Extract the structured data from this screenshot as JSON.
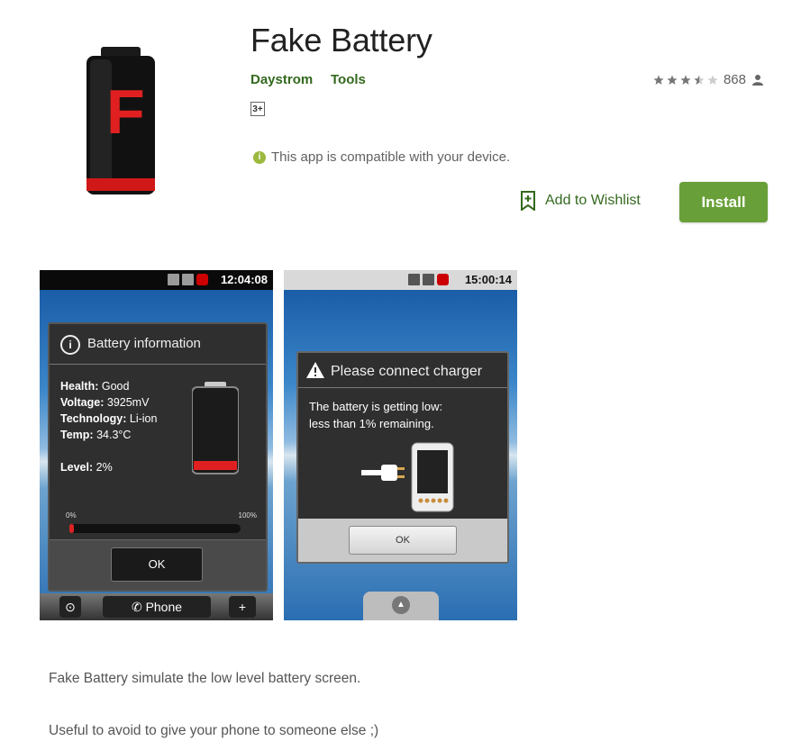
{
  "app": {
    "title": "Fake Battery",
    "developer": "Daystrom",
    "category": "Tools",
    "content_rating": "3+",
    "rating_stars": 3.5,
    "rating_count": "868",
    "compatibility": "This app is compatible with your device.",
    "wishlist_label": "Add to Wishlist",
    "install_label": "Install",
    "icon_letter": "F"
  },
  "screenshots": [
    {
      "status_time": "12:04:08",
      "dialog_title": "Battery information",
      "health_label": "Health:",
      "health_value": "Good",
      "voltage_label": "Voltage:",
      "voltage_value": "3925mV",
      "tech_label": "Technology:",
      "tech_value": "Li-ion",
      "temp_label": "Temp:",
      "temp_value": "34.3°C",
      "level_label": "Level:",
      "level_value": "2%",
      "bar_min": "0%",
      "bar_max": "100%",
      "level_fraction": 0.02,
      "ok_label": "OK",
      "phone_label": "Phone",
      "plus_label": "+"
    },
    {
      "status_time": "15:00:14",
      "dialog_title": "Please connect charger",
      "message_line1": "The battery is getting low:",
      "message_line2": "less than 1% remaining.",
      "ok_label": "OK"
    }
  ],
  "description": [
    "Fake Battery simulate the low level battery screen.",
    "Useful to avoid to give your phone to someone else ;)"
  ],
  "colors": {
    "accent": "#689f38",
    "link": "#33691e",
    "battery_red": "#e02020"
  }
}
